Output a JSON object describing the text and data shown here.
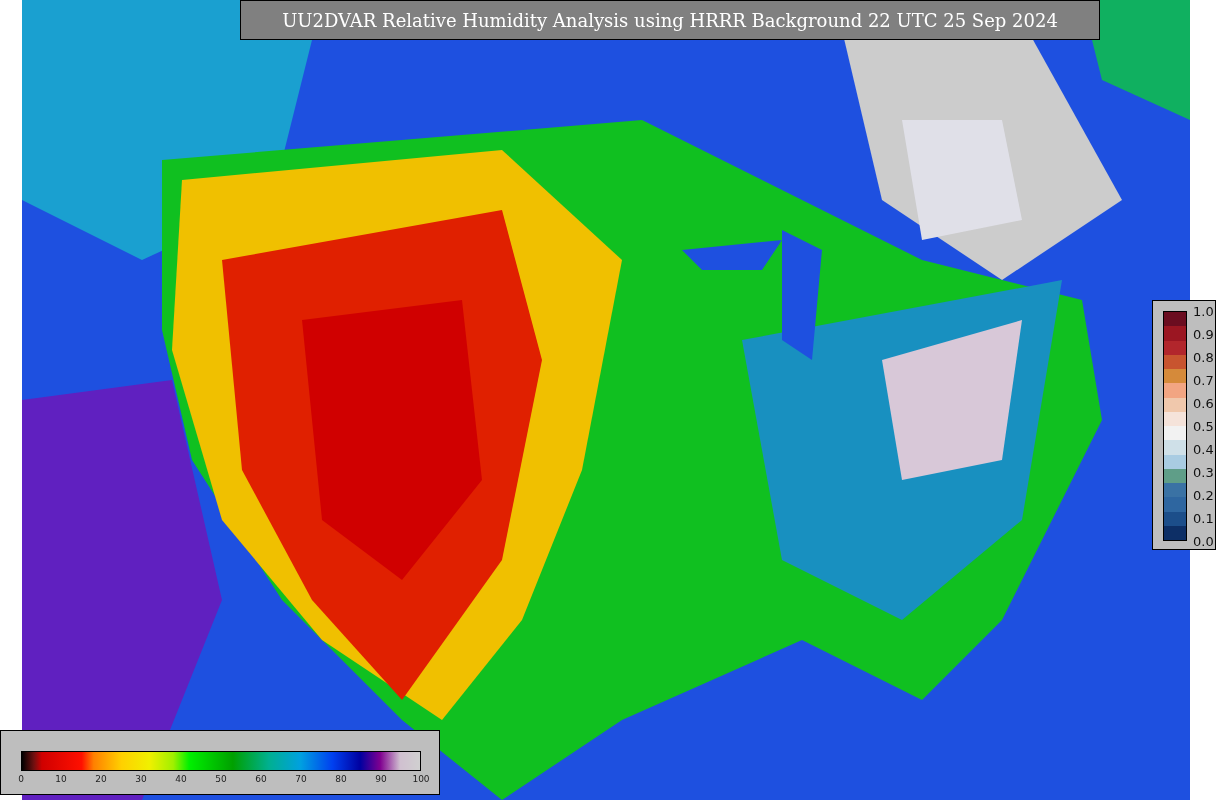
{
  "title": "UU2DVAR Relative Humidity Analysis using HRRR Background 22 UTC 25 Sep 2024",
  "humidity_colorbar": {
    "ticks": [
      "0",
      "10",
      "20",
      "30",
      "40",
      "50",
      "60",
      "70",
      "80",
      "90",
      "100"
    ]
  },
  "ratio_colorbar": {
    "ticks": [
      "1.0",
      "0.9",
      "0.8",
      "0.7",
      "0.6",
      "0.5",
      "0.4",
      "0.3",
      "0.2",
      "0.1",
      "0.0"
    ]
  }
}
